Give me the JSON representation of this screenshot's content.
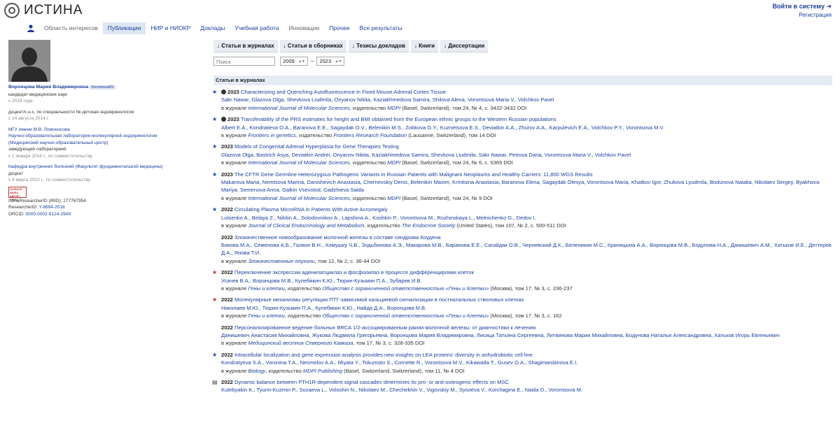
{
  "header": {
    "logo_text": "ИСТИНА",
    "login": "Войти в систему ➜",
    "register": "Регистрация"
  },
  "nav": {
    "items": [
      {
        "label": "Область интересов",
        "state": "inactive"
      },
      {
        "label": "Публикации",
        "state": "active"
      },
      {
        "label": "НИР и НИОКР",
        "state": "normal"
      },
      {
        "label": "Доклады",
        "state": "normal"
      },
      {
        "label": "Учебная работа",
        "state": "normal"
      },
      {
        "label": "Инновации",
        "state": "inactive"
      },
      {
        "label": "Прочее",
        "state": "normal"
      },
      {
        "label": "Все результаты",
        "state": "normal"
      }
    ]
  },
  "profile": {
    "name": "Воронцова Мария Владимировна",
    "badge": "VorontsovaMV",
    "degree": "кандидат медицинских наук",
    "degree_since": "с 2018 года",
    "title": "доцент/с.н.с. по специальности № детская эндокринология",
    "title_since": "с 14 августа 2014 г.",
    "org": "МГУ имени М.В. Ломоносова",
    "lab": "Научно-образовательная лаборатория молекулярной эндокринологии (Медицинский научно-образовательный центр)",
    "lab_role": "заведующий лабораторией",
    "lab_since": "с 1 января 2016 г., по совместительству",
    "dept": "Кафедра внутренних болезней (Факультет фундаментальной медицины)",
    "dept_role": "доцент",
    "dept_since": "с 4 марта 2022 г., по совместительству",
    "science_index_lines": [
      "SCIENCE INDEX",
      "АВТОР",
      "РИНЦ"
    ],
    "ids": [
      {
        "label": "IstinaResearcherID (IRID): ",
        "value": "277767954",
        "link": false
      },
      {
        "label": "ResearcherID: ",
        "value": "Y-8894-2018",
        "link": true
      },
      {
        "label": "ORCID: ",
        "value": "0000-0002-9124-294X",
        "link": true
      }
    ]
  },
  "toolbar": {
    "buttons": [
      "↓ Статьи в журналах",
      "↓ Статьи в сборниках",
      "↓ Тезисы докладов",
      "↓ Книги",
      "↓ Диссертации"
    ]
  },
  "filters": {
    "search_placeholder": "Поиск",
    "year_from": "2009",
    "year_to": "2023",
    "dash": "–"
  },
  "section_title": "Статьи в журналах",
  "icon_names": {
    "star-blue": "blue-star-icon",
    "star-red": "red-star-icon",
    "doc": "document-icon"
  },
  "publications": [
    {
      "icon": "star-blue",
      "globe": true,
      "year": "2023",
      "title": "Characterizing and Quenching Autofluorescence in Fixed Mouse Adrenal Cortex Tissue",
      "authors": "Sakr Nawar, Glazova Olga, Shevkova Liudmila, Onyanov Nikita, Kaziakhmedova Samira, Shilova Alena, Vorontsova Maria V., Volchkov Pavel",
      "prefix": "в журнале ",
      "journal": "International Journal of Molecular Sciences",
      "mid": ", издательство ",
      "publisher": "MDPI",
      "rest": " (Basel, Switzerland), том 24, № 4, с. 3432-3432 DOI"
    },
    {
      "icon": "star-blue",
      "globe": true,
      "year": "2023",
      "title": "Transferability of the PRS estimates for height and BMI obtained from the European ethnic groups to the Western Russian populations",
      "authors": "Albert E.A., Kondratieva O.A., Baranova E.E., Sagaydak O.V., Belenikin M.S., Zobkova G.Y., Kuznetsova E.S., Deviatkin A.A., Zhurov A.A., Karpulevich E.A., Volchkov P.Y., Vorontsova M.V.",
      "prefix": "в журнале ",
      "journal": "Frontiers in genetics",
      "mid": ", издательство ",
      "publisher": "Frontiers Research Foundation",
      "rest": " (Lausanne, Switzerland), том 14 DOI"
    },
    {
      "icon": "star-blue",
      "globe": false,
      "year": "2023",
      "title": "Models of Congenital Adrenal Hyperplasia for Gene Therapies Testing",
      "authors": "Glazova Olga, Bastrich Asya, Deviatkin Andrei, Onyanov Nikita, Kaziakhmedova Samira, Shevkova Liudmila, Sakr Nawar, Petrova Daria, Vorontsova Maria V., Volchkov Pavel",
      "prefix": "в журнале ",
      "journal": "International Journal of Molecular Sciences",
      "mid": ", издательство ",
      "publisher": "MDPI",
      "rest": " (Basel, Switzerland), том 24, № 6, с. 5365 DOI"
    },
    {
      "icon": "star-blue",
      "globe": false,
      "year": "2023",
      "title": "The CFTR Gene Germline Heterozygous Pathogenic Variants in Russian Patients with Malignant Neoplasms and Healthy Carriers: 11,800 WGS Results",
      "authors": "Makarova Maria, Nemtsova Marina, Danishevich Anastasia, Chernevskiy Denis, Belenikin Maxim, Krinitsina Anastasia, Baranova Elena, Sagaydak Olesya, Vorontsova Maria, Khatkov Igor, Zhukova Lyudmila, Bodunova Natalia, Nikolaev Sergey, Byakhova Mariya, Semenova Anna, Galkin Vsevolod, Gadzhieva Saida",
      "prefix": "в журнале ",
      "journal": "International Journal of Molecular Sciences",
      "mid": ", издательство ",
      "publisher": "MDPI",
      "rest": " (Basel, Switzerland), том 24, № 9 DOI"
    },
    {
      "icon": "star-blue",
      "globe": false,
      "year": "2022",
      "title": "Circulating Plasma MicroRNA in Patients With Active Acromegaly",
      "authors": "Lutsenko A., Belaya Z., Nikitin A., Solodovnikov A., Lapshina A., Koshkin P., Vorontsova M., Rozhinskaya L., Melnichenko G., Dedov I.",
      "prefix": "в журнале ",
      "journal": "Journal of Clinical Endocrinology and Metabolism",
      "mid": ", издательство ",
      "publisher": "The Endocrine Society",
      "rest": " (United States), том 107, № 2, с. 500-511 DOI"
    },
    {
      "icon": "none",
      "globe": false,
      "year": "2022",
      "title": "Злокачественное новообразование молочной железы в составе синдрома Коудена",
      "authors": "Бякова М.А., Семенова А.Б., Галкин В.Н., Хомушку Ч.В., Зодьбинова А.Э., Макарова М.В., Баранова Е.Е., Сагайдак О.В., Черневский Д.К., Беленикин М.С., Криницына А.А., Воронцова М.В., Бодунова Н.А., Данишевич А.М., Хатьков И.Е., Деттерев Д.А., Янова Т.И.",
      "prefix": "в журнале ",
      "journal": "Злокачественные опухоли",
      "mid": "",
      "publisher": "",
      "rest": ", том 12, № 2, с. 36-44 DOI"
    },
    {
      "icon": "star-red",
      "globe": false,
      "year": "2022",
      "title": "Переключение экспрессии аденилатциклаз и фосфолипаз в процессе дифференцировки клеток",
      "authors": "Усачев В.А., Воронцова М.В., Кулебякин К.Ю., Тюрин-Кузьмин П.А., Зубарев И.В.",
      "prefix": "в журнале ",
      "journal": "Гены и клетки",
      "mid": ", издательство ",
      "publisher": "Общество с ограниченной ответственностью «Гены и Клетки»",
      "rest": " (Москва), том 17, № 3, с. 236-237"
    },
    {
      "icon": "star-red",
      "globe": false,
      "year": "2022",
      "title": "Молекулярные механизмы регуляции ПТГ-зависимой кальциевой сигнализации в постнатальных стволовых клетках",
      "authors": "Николаев М.Ю., Тюрин-Кузьмин П.А., Кулебякин К.Ю., Найда Д.А., Воронцова М.В.",
      "prefix": "в журнале ",
      "journal": "Гены и клетки",
      "mid": ", издательство ",
      "publisher": "Общество с ограниченной ответственностью «Гены и Клетки»",
      "rest": " (Москва), том 17, № 3, с. 162"
    },
    {
      "icon": "none",
      "globe": false,
      "year": "2022",
      "title": "Персонализированное ведение больных BRCA 1/2-ассоциированным раком молочной железы: от диагностики к лечению",
      "authors": "Данишевич Анастасия Михайловна, Жукова Людмила Григорьевна, Воронцова Мария Владимировна, Лисица Татьяна Сергеевна, Литвинова Мария Михайловна, Бодунова Наталья Александровна, Хатьков Игорь Евгеньевич",
      "prefix": "в журнале ",
      "journal": "Медицинский вестник Северного Кавказа",
      "mid": "",
      "publisher": "",
      "rest": ", том 17, № 3, с. 328-335 DOI"
    },
    {
      "icon": "star-blue",
      "globe": false,
      "year": "2022",
      "title": "Intracellular localization and gene expression analysis provides new insights on LEA proteins' diversity in anhydrobiotic cell line",
      "authors": "Kondratyeva S.A., Voronina T.A., Nesmelov A.A., Miyata Y., Tokumoto S., Cornette R., Vorontsova M.V., Kikawada T., Gusev O.A., Shagimardanova E.I.",
      "prefix": "в журнале ",
      "journal": "Biology",
      "mid": ", издательство ",
      "publisher": "MDPI Publishing",
      "rest": " (Basel, Switzerland, Switzerland), том 11, № 4 DOI"
    },
    {
      "icon": "doc",
      "globe": false,
      "year": "2022",
      "title": "Dynamic balance between PTH1R-dependent signal cascades determines its pro- or anti-osteogenic effects on MSC",
      "authors": "Kulebyakin K., Tyurin-Kuzmin P., Sozaeva L., Voloshin N., Nikolaev M., Chechekhin V., Vigovskiy M., Sysoeva V., Korchagina E., Naida D., Vorontsova M.",
      "prefix": "",
      "journal": "",
      "mid": "",
      "publisher": "",
      "rest": ""
    }
  ]
}
